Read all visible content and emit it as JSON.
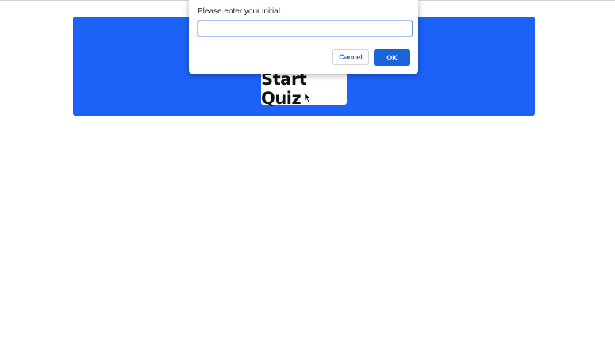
{
  "hero": {
    "start_button_label": "Start Quiz"
  },
  "prompt_dialog": {
    "message": "Please enter your initial.",
    "input_value": "",
    "cancel_label": "Cancel",
    "ok_label": "OK"
  },
  "colors": {
    "hero_background": "#1c62f7",
    "ok_button": "#1a63d8",
    "cancel_text": "#2563c9"
  },
  "icons": {
    "pointer": "mouse-pointer-icon"
  }
}
